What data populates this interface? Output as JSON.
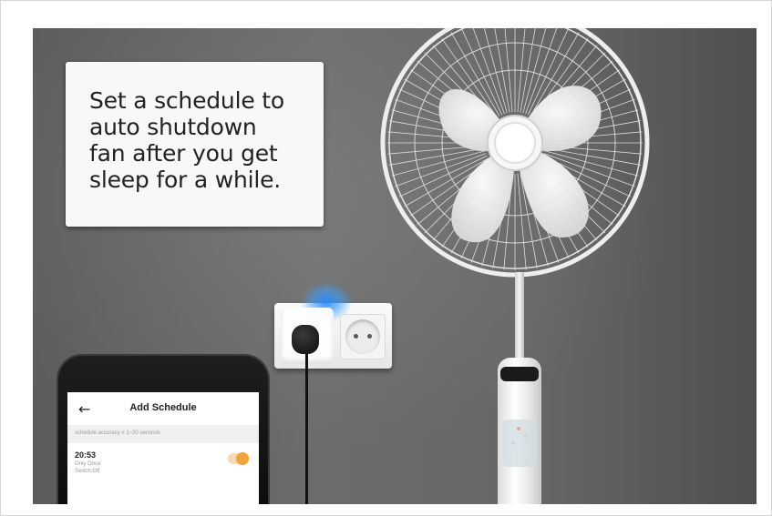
{
  "caption": {
    "text": "Set a schedule to\nauto shutdown\nfan after you get\nsleep for a while."
  },
  "app": {
    "title": "Add Schedule",
    "back_icon": "←",
    "notice": "schedule accuracy ± 1~30 seconds",
    "schedule": {
      "time": "20:53",
      "repeat": "Only Once",
      "action": "Switch:Off",
      "enabled": true
    },
    "accent_color": "#f2a23a"
  }
}
